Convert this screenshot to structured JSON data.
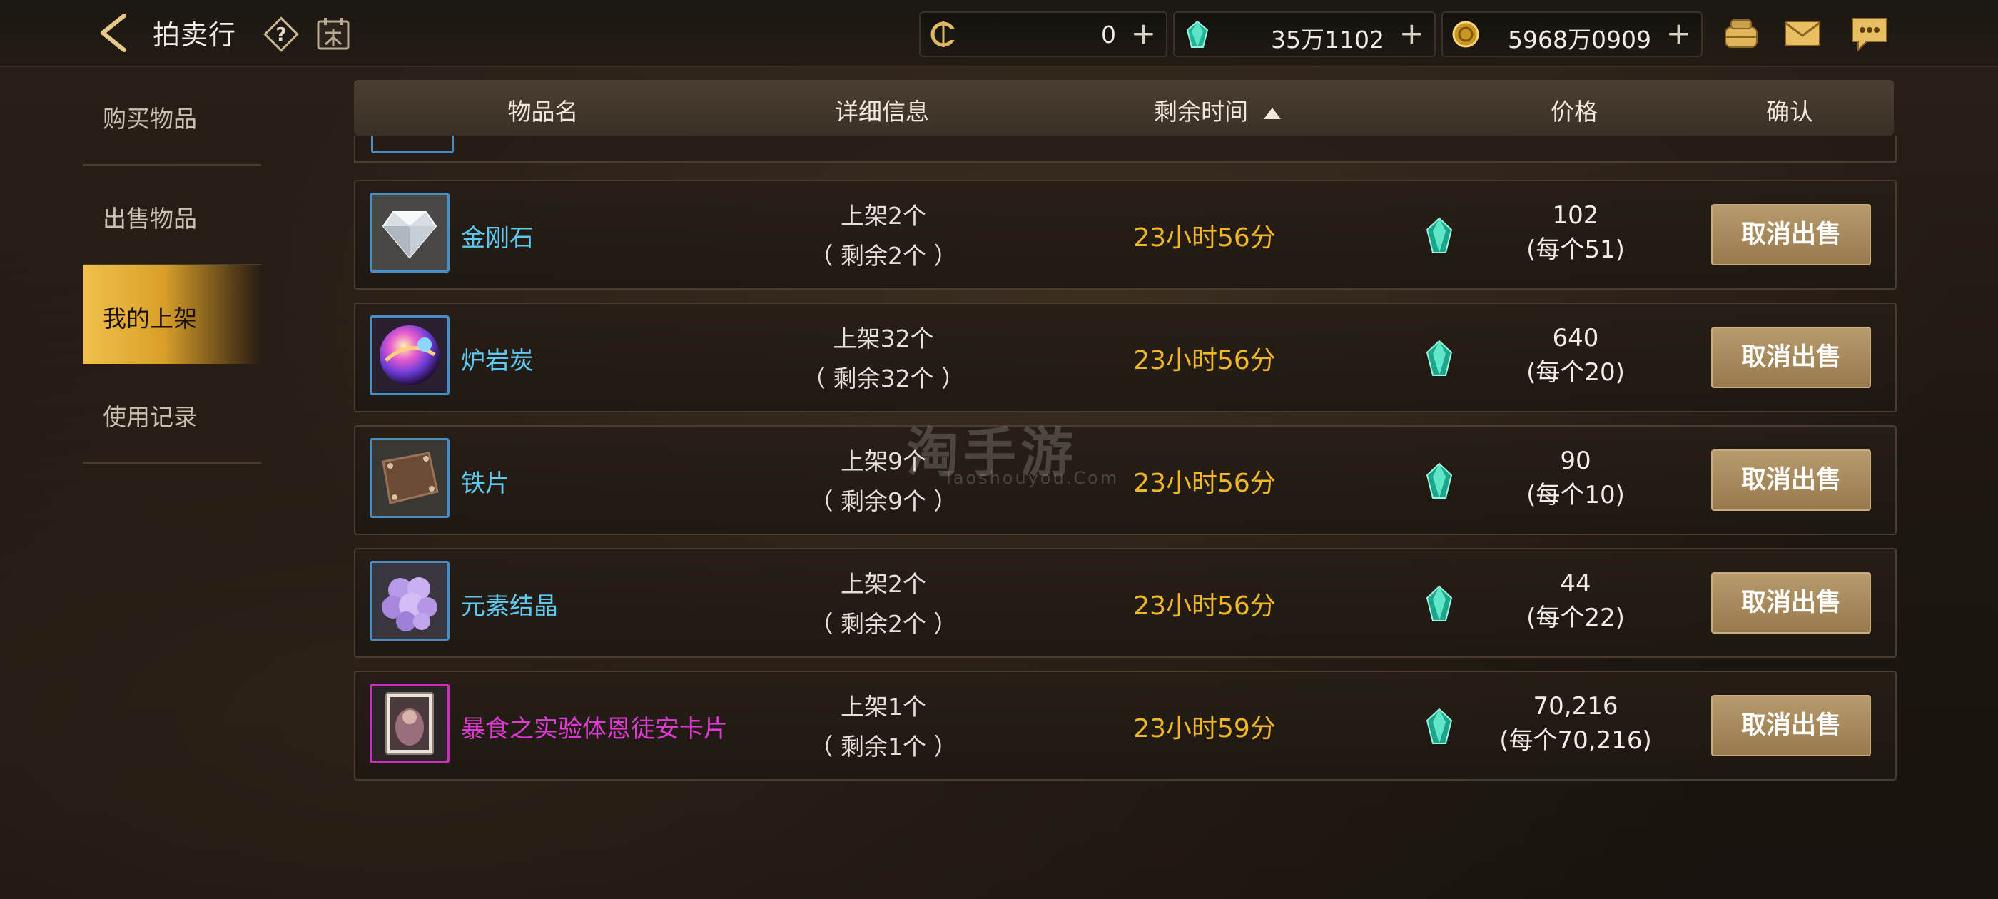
{
  "topbar": {
    "title": "拍卖行",
    "currencies": [
      {
        "icon": "bound-currency-icon",
        "value": "0"
      },
      {
        "icon": "gem-icon",
        "value": "35万1102"
      },
      {
        "icon": "gold-coin-icon",
        "value": "5968万0909"
      }
    ],
    "plus_symbol": "+"
  },
  "sidebar": {
    "items": [
      {
        "label": "购买物品"
      },
      {
        "label": "出售物品"
      },
      {
        "label": "我的上架"
      },
      {
        "label": "使用记录"
      }
    ]
  },
  "table": {
    "headers": {
      "name": "物品名",
      "detail": "详细信息",
      "time": "剩余时间",
      "price": "价格",
      "confirm": "确认"
    },
    "rows": [
      {
        "name": "金刚石",
        "listed": "上架2个",
        "remaining": "（ 剩余2个 ）",
        "time": "23小时56分",
        "price": "102",
        "unit_price": "(每个51)",
        "action": "取消出售"
      },
      {
        "name": "炉岩炭",
        "listed": "上架32个",
        "remaining": "（ 剩余32个 ）",
        "time": "23小时56分",
        "price": "640",
        "unit_price": "(每个20)",
        "action": "取消出售"
      },
      {
        "name": "铁片",
        "listed": "上架9个",
        "remaining": "（ 剩余9个 ）",
        "time": "23小时56分",
        "price": "90",
        "unit_price": "(每个10)",
        "action": "取消出售"
      },
      {
        "name": "元素结晶",
        "listed": "上架2个",
        "remaining": "（ 剩余2个 ）",
        "time": "23小时56分",
        "price": "44",
        "unit_price": "(每个22)",
        "action": "取消出售"
      },
      {
        "name": "暴食之实验体恩徒安卡片",
        "listed": "上架1个",
        "remaining": "（ 剩余1个 ）",
        "time": "23小时59分",
        "price": "70,216",
        "unit_price": "(每个70,216)",
        "action": "取消出售"
      }
    ]
  },
  "watermark": {
    "main": "淘手游",
    "sub": "Taoshouyou.Com"
  },
  "colors": {
    "accent_gold": "#f2b824",
    "item_blue": "#5fc8f0",
    "item_purple": "#e03ad6",
    "active_tab": "#f1c14a",
    "button": "#a88a5b"
  }
}
